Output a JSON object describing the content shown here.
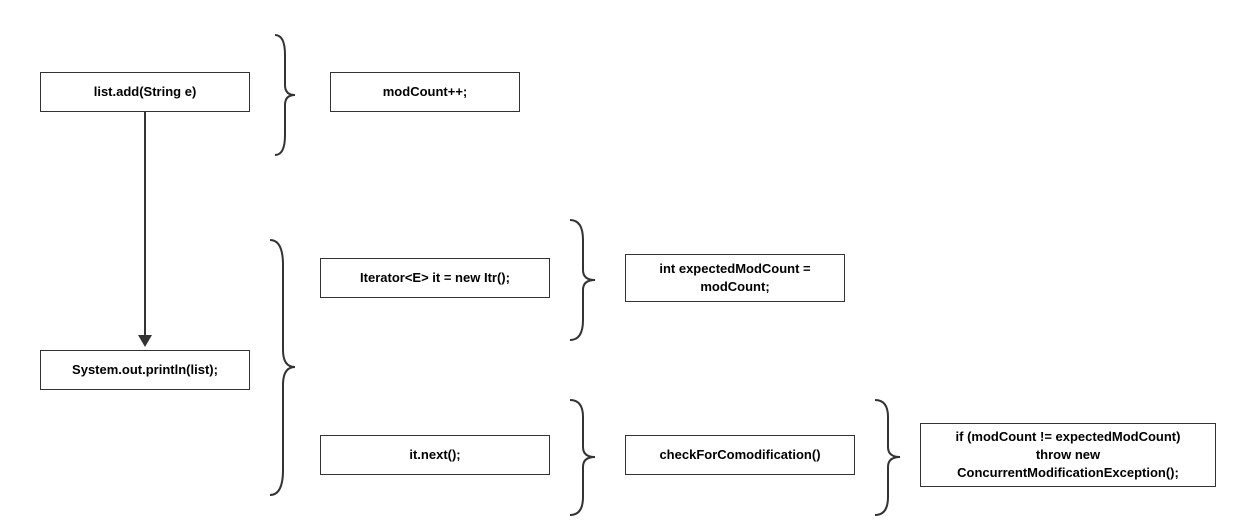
{
  "boxes": {
    "listAdd": "list.add(String e)",
    "modCount": "modCount++;",
    "println": "System.out.println(list);",
    "iterator": "Iterator<E> it = new Itr();",
    "expectedMod": "int expectedModCount = modCount;",
    "itNext": "it.next();",
    "checkFor": "checkForComodification()",
    "ifModCount": "if (modCount != expectedModCount)\nthrow new\nConcurrentModificationException();"
  }
}
